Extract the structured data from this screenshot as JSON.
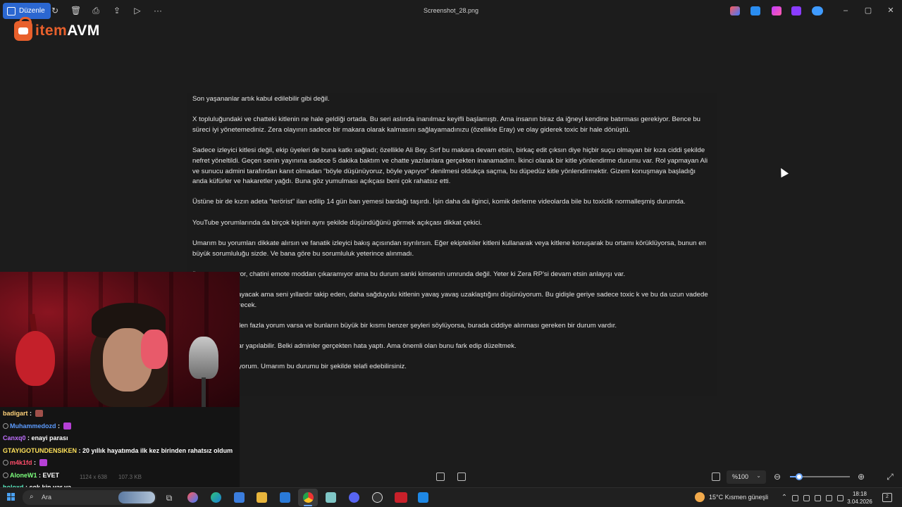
{
  "window": {
    "edit_label": "Düzenle",
    "filename": "Screenshot_28.png"
  },
  "logo": {
    "part1": "item",
    "part2": "AVM"
  },
  "document": {
    "paragraphs": [
      "Son yaşananlar artık kabul edilebilir gibi değil.",
      "X topluluğundaki ve chatteki kitlenin ne hale geldiği ortada. Bu seri aslında inanılmaz keyifli başlamıştı. Ama insanın biraz da iğneyi kendine batırması gerekiyor. Bence bu süreci iyi yönetemediniz. Zera olayının sadece bir makara olarak kalmasını sağlayamadınızu (özellikle Eray) ve olay giderek toxic bir hale dönüştü.",
      "Sadece izleyici kitlesi değil, ekip üyeleri de buna katkı sağladı; özellikle Ali Bey. Sırf bu makara devam etsin, birkaç edit çıksın diye hiçbir suçu olmayan bir kıza ciddi şekilde nefret yöneltildi. Geçen senin yayınına sadece 5 dakika baktım ve chatte yazılanlara gerçekten inanamadım. İkinci olarak bir kitle yönlendirme durumu var. Rol yapmayan Ali ve sunucu admini tarafından kanıt olmadan “böyle düşünüyoruz, böyle yapıyor” denilmesi oldukça saçma, bu düpedüz kitle yönlendirmektir. Gizem konuşmaya başladığı anda küfürler ve hakaretler yağdı. Buna göz yumulması açıkçası beni çok rahatsız etti.",
      "Üstüne bir de kızın adeta “terörist” ilan edilip 14 gün ban yemesi bardağı taşırdı. İşin daha da ilginci, komik derleme videolarda bile bu toxiclik normalleşmiş durumda.",
      "YouTube yorumlarında da birçok kişinin aynı şekilde düşündüğünü görmek açıkçası dikkat çekici.",
      "Umarım bu yorumları dikkate alırsın ve fanatik izleyici bakış açısından sıyrılırsın. Eğer ekiptekiler kitleni kullanarak veya kitlene konuşarak bu ortamı körüklüyorsa, bunun en büyük sorumluluğu sizde. Ve bana göre bu sorumluluk yeterince alınmadı.",
      "ür yayın açamıyor, chatini emote moddan çıkaramıyor ama bu durum sanki kimsenin umrunda değil. Yeter ki Zera RP’si devam etsin anlayışı var.",
      "çok önemli olmayacak ama seni yıllardır takip eden, daha sağduyulu kitlenin yavaş yavaş uzaklaştığını düşünüyorum. Bu gidişle geriye sadece toxic k ve bu da uzun vadede sizlere zarar verecek.",
      "un altında 700’den fazla yorum varsa ve bunların büyük bir kısmı benzer şeyleri söylüyorsa, burada ciddiye alınması gereken bir durum vardır.",
      "ısansınız, hatalar yapılabilir. Belki adminler gerçekten hata yaptı. Ama önemli olan bunu fark edip düzeltmek.",
      "da başarılar diliyorum. Umarım bu durumu bir şekilde telafi edebilirsiniz."
    ]
  },
  "chat": [
    {
      "user": "badigart",
      "color": "#ffd27a",
      "msg": "",
      "badge": false,
      "emote": "#a0504a"
    },
    {
      "user": "Muhammedozd",
      "color": "#5c9cff",
      "msg": "",
      "badge": true,
      "emote": "#b640d6"
    },
    {
      "user": "Canxq0",
      "color": "#c070ff",
      "msg": "enayi parası",
      "badge": false,
      "emote": ""
    },
    {
      "user": "GTAYIGOTUNDENSIKEN",
      "color": "#ffe25a",
      "msg": "20 yıllık hayatımda ilk kez birinden rahatsız oldum",
      "badge": false,
      "emote": ""
    },
    {
      "user": "m4k1fd",
      "color": "#ff4d6a",
      "msg": "",
      "badge": true,
      "emote": "#b640d6"
    },
    {
      "user": "AloneW1",
      "color": "#7dff7d",
      "msg": "EVET",
      "badge": true,
      "emote": ""
    },
    {
      "user": "holoxd",
      "color": "#5cf0c6",
      "msg": "çok kin var ya",
      "badge": false,
      "emote": ""
    }
  ],
  "viewer": {
    "dimensions": "1124 x 638",
    "filesize": "107.3 KB",
    "zoom": "%100",
    "zoom_level": 0.15
  },
  "taskbar": {
    "search_placeholder": "Ara",
    "weather": "15°C  Kısmen güneşli",
    "time": "18:18",
    "date": "3.04.2026",
    "notifications": "2"
  },
  "colors": {
    "accent": "#2b67d1",
    "brand_orange": "#e8602c"
  }
}
